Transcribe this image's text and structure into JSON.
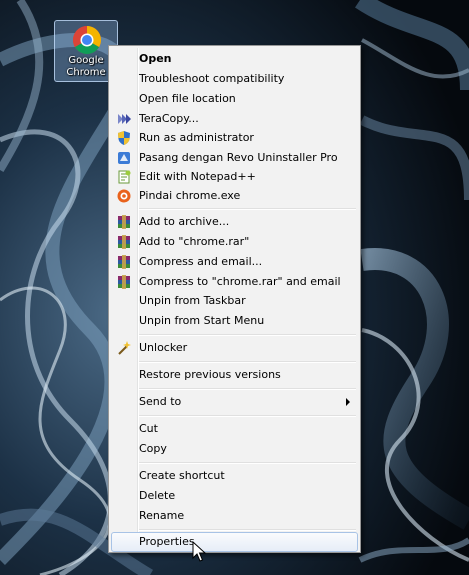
{
  "desktop": {
    "icon_label": "Google Chrome",
    "icon_name": "chrome-icon"
  },
  "menu": {
    "items": [
      {
        "id": "open",
        "label": "Open",
        "bold": true,
        "icon": ""
      },
      {
        "id": "troubleshoot",
        "label": "Troubleshoot compatibility",
        "icon": ""
      },
      {
        "id": "open-location",
        "label": "Open file location",
        "icon": ""
      },
      {
        "id": "teracopy",
        "label": "TeraCopy...",
        "icon": "teracopy-icon"
      },
      {
        "id": "run-admin",
        "label": "Run as administrator",
        "icon": "uac-shield-icon"
      },
      {
        "id": "revo",
        "label": "Pasang dengan Revo Uninstaller Pro",
        "icon": "revo-uninstaller-icon"
      },
      {
        "id": "notepadpp",
        "label": "Edit with Notepad++",
        "icon": "notepadpp-icon"
      },
      {
        "id": "scan",
        "label": "Pindai chrome.exe",
        "icon": "antivirus-icon"
      },
      {
        "id": "add-archive",
        "label": "Add to archive...",
        "icon": "winrar-icon"
      },
      {
        "id": "add-rar",
        "label": "Add to \"chrome.rar\"",
        "icon": "winrar-icon"
      },
      {
        "id": "compress-email",
        "label": "Compress and email...",
        "icon": "winrar-icon"
      },
      {
        "id": "compress-rar-email",
        "label": "Compress to \"chrome.rar\" and email",
        "icon": "winrar-icon"
      },
      {
        "id": "unpin-taskbar",
        "label": "Unpin from Taskbar",
        "icon": ""
      },
      {
        "id": "unpin-start",
        "label": "Unpin from Start Menu",
        "icon": ""
      },
      {
        "id": "unlocker",
        "label": "Unlocker",
        "icon": "unlocker-wand-icon"
      },
      {
        "id": "restore",
        "label": "Restore previous versions",
        "icon": ""
      },
      {
        "id": "send-to",
        "label": "Send to",
        "icon": "",
        "submenu": true
      },
      {
        "id": "cut",
        "label": "Cut",
        "icon": ""
      },
      {
        "id": "copy",
        "label": "Copy",
        "icon": ""
      },
      {
        "id": "create-shortcut",
        "label": "Create shortcut",
        "icon": ""
      },
      {
        "id": "delete",
        "label": "Delete",
        "icon": ""
      },
      {
        "id": "rename",
        "label": "Rename",
        "icon": ""
      },
      {
        "id": "properties",
        "label": "Properties",
        "icon": "",
        "highlighted": true
      }
    ]
  },
  "colors": {
    "menu_bg": "#f2f2f2",
    "menu_border": "#979797",
    "hover_border": "#a8c3e6",
    "desktop_bg": "#0b1620"
  }
}
